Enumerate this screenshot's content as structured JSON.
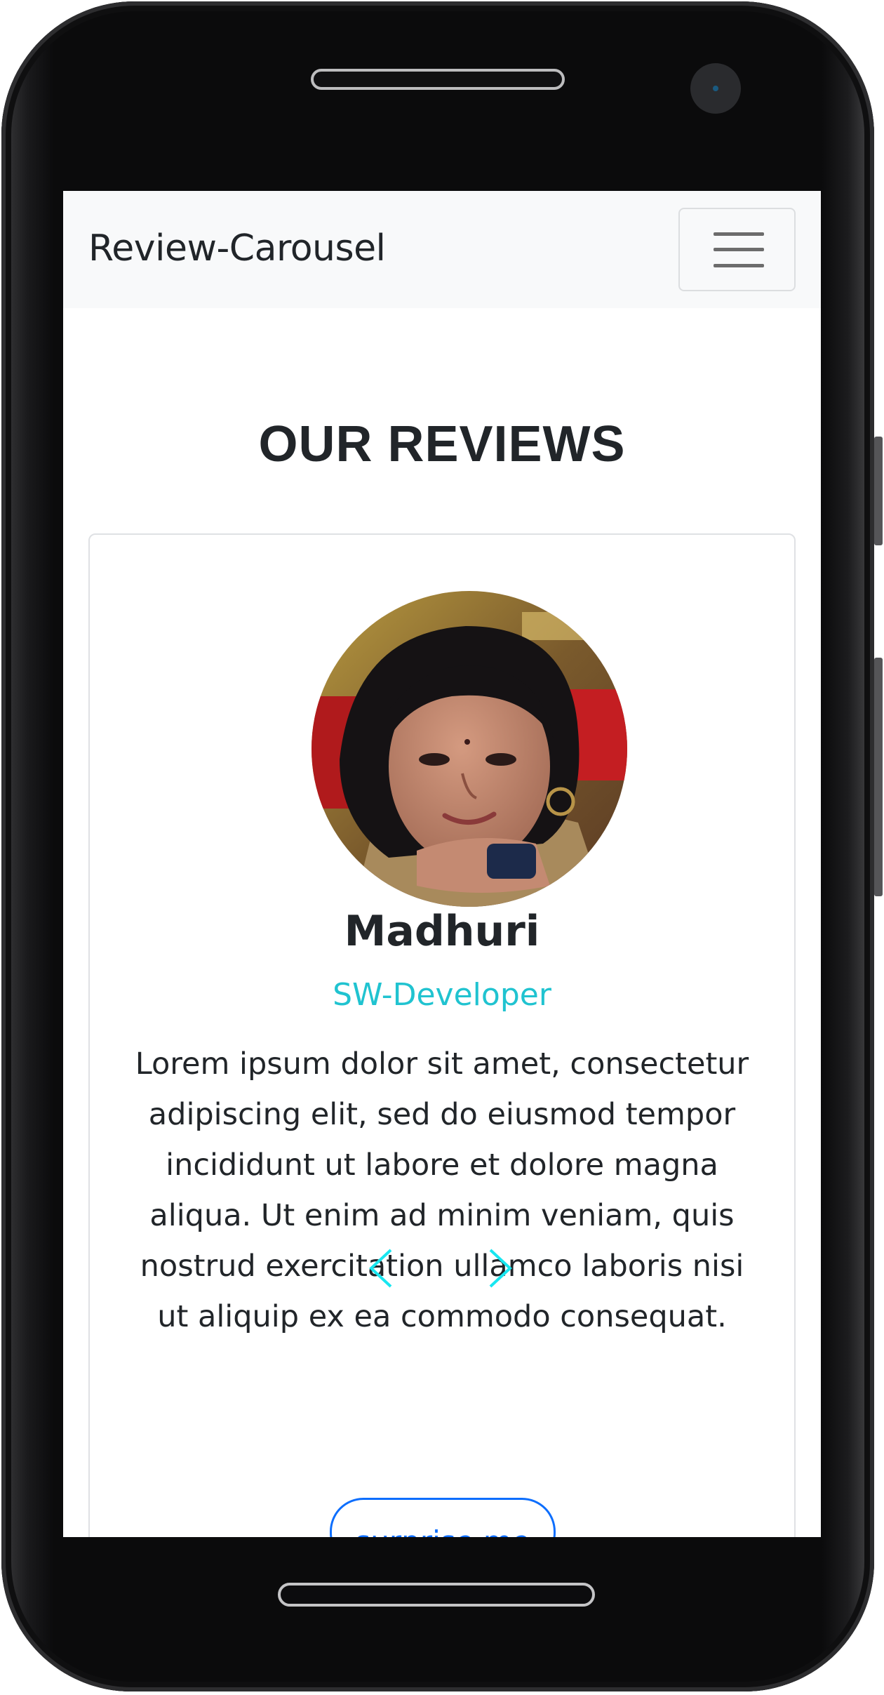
{
  "navbar": {
    "brand": "Review-Carousel",
    "toggler_icon": "hamburger-menu-icon"
  },
  "main": {
    "title": "OUR REVIEWS"
  },
  "review": {
    "image_alt": "Madhuri",
    "name": "Madhuri",
    "job": "SW-Developer",
    "text": "Lorem ipsum dolor sit amet, consectetur adipiscing elit, sed do eiusmod tempor incididunt ut labore et dolore magna aliqua. Ut enim ad minim veniam, quis nostrud exercitation ullamco laboris nisi ut aliquip ex ea commodo consequat.",
    "prev_icon": "chevron-left-icon",
    "next_icon": "chevron-right-icon",
    "random_button": "surprise me"
  },
  "colors": {
    "job": "#20c3d0",
    "chevrons": "#18e6f0",
    "button": "#0d6efd",
    "navbar_bg": "#f8f9fa"
  }
}
